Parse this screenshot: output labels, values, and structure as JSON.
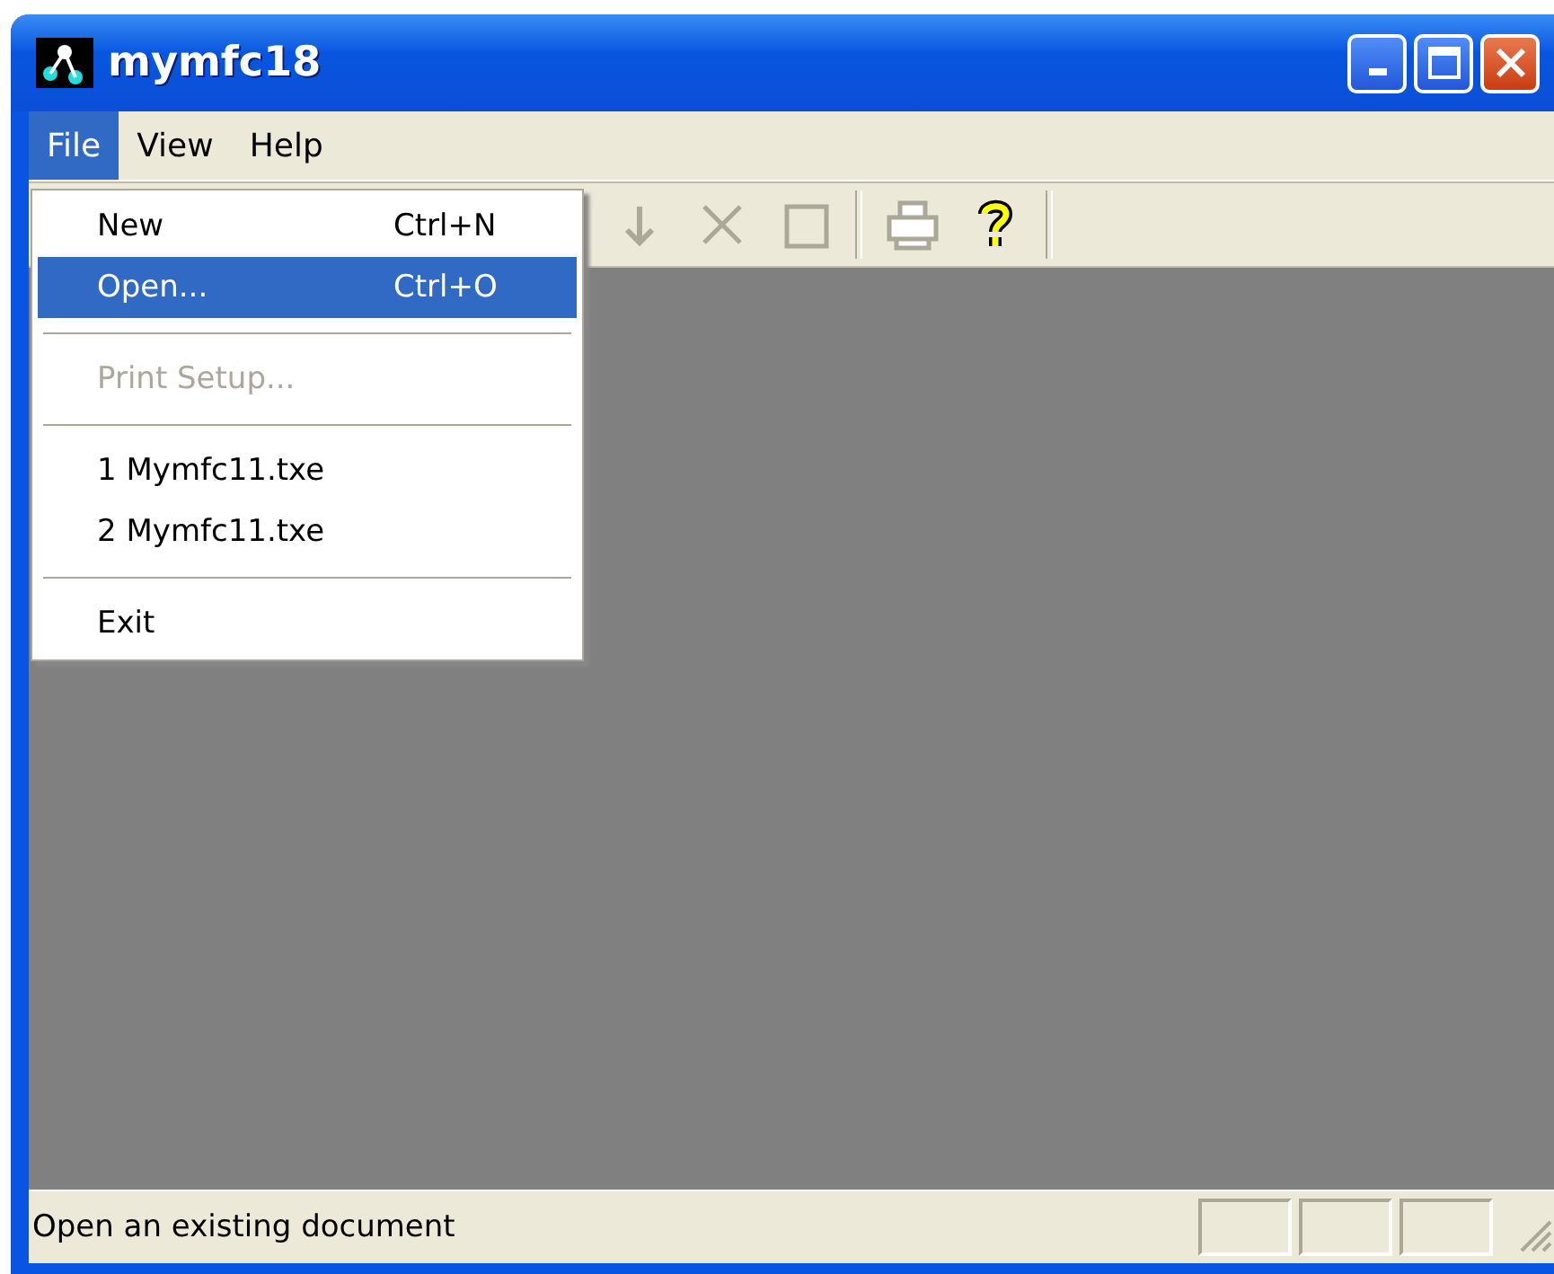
{
  "window": {
    "title": "mymfc18"
  },
  "menu_bar": [
    {
      "label": "File",
      "selected": true
    },
    {
      "label": "View",
      "selected": false
    },
    {
      "label": "Help",
      "selected": false
    }
  ],
  "toolbar": [
    {
      "kind": "arrow",
      "disabled": true
    },
    {
      "kind": "cross",
      "disabled": true
    },
    {
      "kind": "square",
      "disabled": true
    },
    {
      "kind": "separator"
    },
    {
      "kind": "printer",
      "disabled": true
    },
    {
      "kind": "help",
      "disabled": false
    },
    {
      "kind": "separator"
    }
  ],
  "file_menu": [
    {
      "kind": "command",
      "label": "New",
      "shortcut": "Ctrl+N",
      "selected": false,
      "disabled": false
    },
    {
      "kind": "command",
      "label": "Open...",
      "shortcut": "Ctrl+O",
      "selected": true,
      "disabled": false
    },
    {
      "kind": "separator"
    },
    {
      "kind": "command",
      "label": "Print Setup...",
      "selected": false,
      "disabled": true
    },
    {
      "kind": "separator"
    },
    {
      "kind": "command",
      "label": "1 Mymfc11.txe",
      "selected": false,
      "disabled": false
    },
    {
      "kind": "command",
      "label": "2 Mymfc11.txe",
      "selected": false,
      "disabled": false
    },
    {
      "kind": "separator"
    },
    {
      "kind": "command",
      "label": "Exit",
      "selected": false,
      "disabled": false
    }
  ],
  "status_bar": {
    "message": "Open an existing document"
  }
}
